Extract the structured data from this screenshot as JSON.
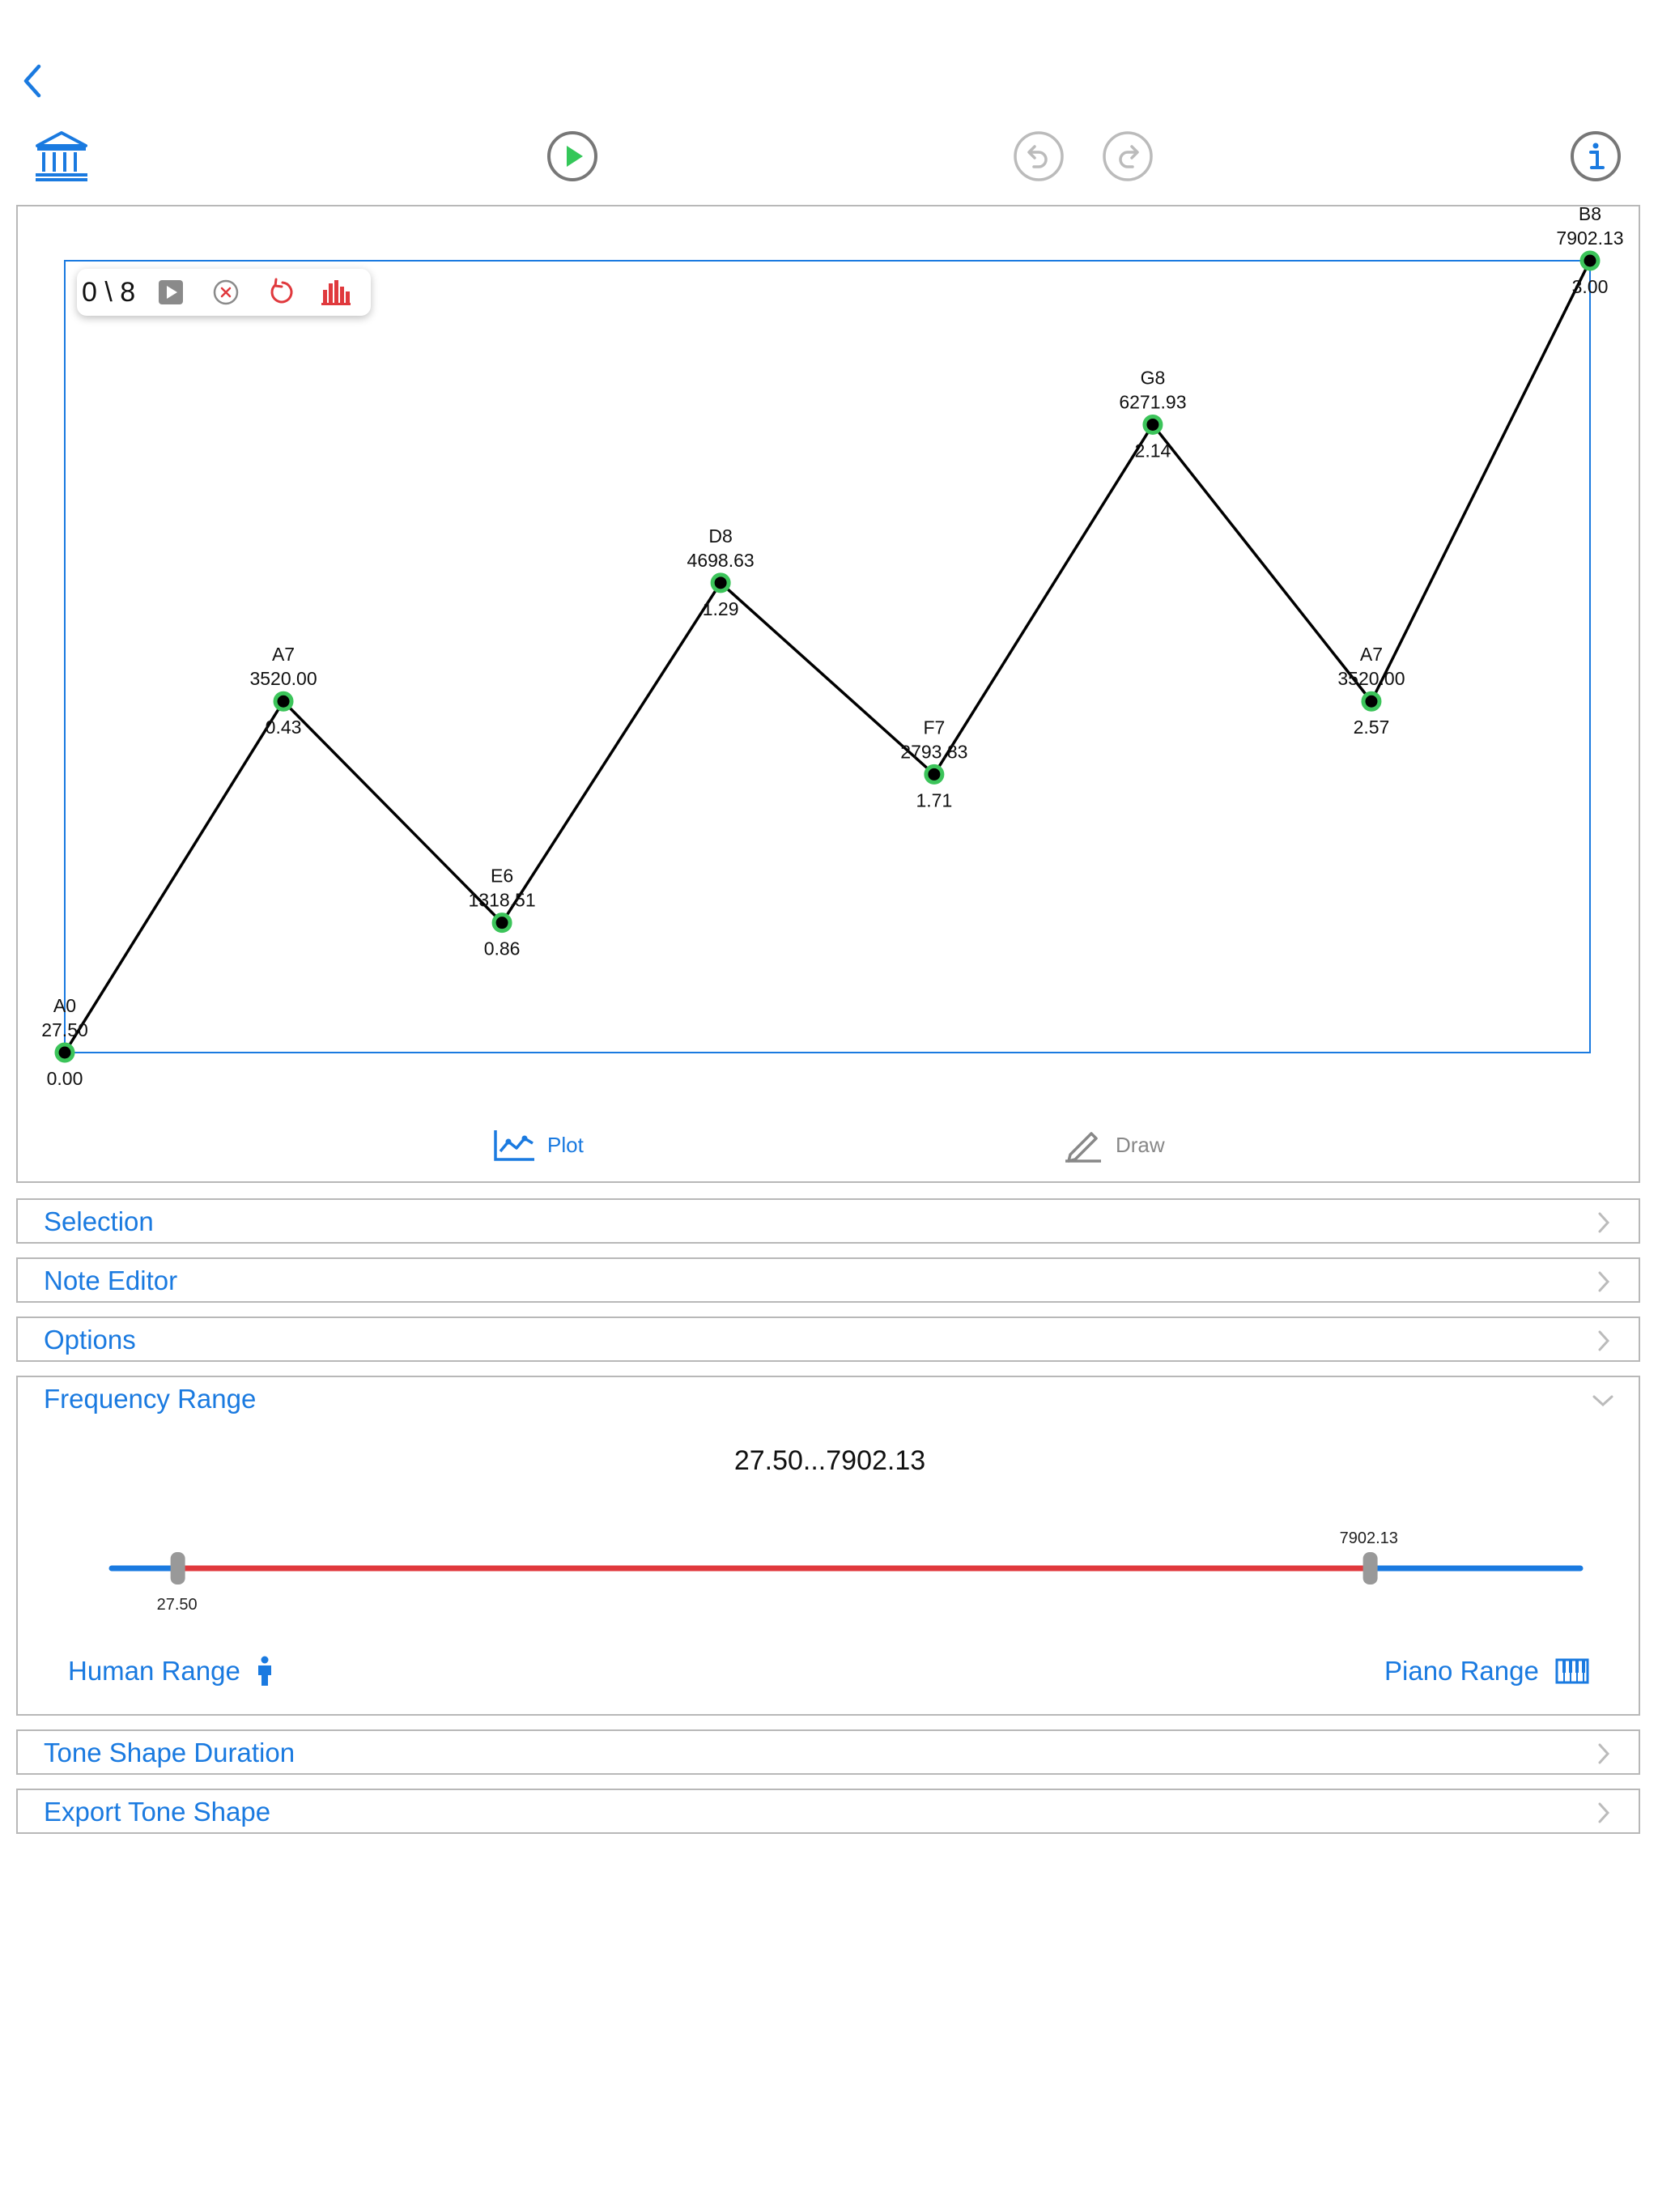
{
  "toolbar": {
    "back_icon": "chevron-left-icon",
    "library_icon": "bank-columns-icon",
    "play_icon": "play-circle-icon",
    "undo_icon": "undo-circle-icon",
    "redo_icon": "redo-circle-icon",
    "info_icon": "info-circle-icon"
  },
  "mini_toolbar": {
    "counter": "0 \\ 8"
  },
  "chart_data": {
    "type": "line",
    "points": [
      {
        "note": "A0",
        "freq": "27.50",
        "time": "0.00"
      },
      {
        "note": "A7",
        "freq": "3520.00",
        "time": "0.43"
      },
      {
        "note": "E6",
        "freq": "1318.51",
        "time": "0.86"
      },
      {
        "note": "D8",
        "freq": "4698.63",
        "time": "1.29"
      },
      {
        "note": "F7",
        "freq": "2793.83",
        "time": "1.71"
      },
      {
        "note": "G8",
        "freq": "6271.93",
        "time": "2.14"
      },
      {
        "note": "A7",
        "freq": "3520.00",
        "time": "2.57"
      },
      {
        "note": "B8",
        "freq": "7902.13",
        "time": "3.00"
      }
    ],
    "x_values": [
      0.0,
      0.43,
      0.86,
      1.29,
      1.71,
      2.14,
      2.57,
      3.0
    ],
    "y_values": [
      27.5,
      3520.0,
      1318.51,
      4698.63,
      2793.83,
      6271.93,
      3520.0,
      7902.13
    ],
    "xlim": [
      0,
      3.0
    ],
    "ylim": [
      27.5,
      7902.13
    ],
    "line_color": "#000000",
    "point_color": "#3cc45a",
    "frame_color": "#1a7ae0"
  },
  "tabs": {
    "plot_label": "Plot",
    "draw_label": "Draw"
  },
  "sections": {
    "selection": "Selection",
    "note_editor": "Note Editor",
    "options": "Options",
    "frequency_range": "Frequency Range",
    "tone_shape_duration": "Tone Shape Duration",
    "export_tone_shape": "Export Tone Shape"
  },
  "frequency_range": {
    "range_text": "27.50...7902.13",
    "low_label": "27.50",
    "high_label": "7902.13",
    "low_fraction": 0.045,
    "high_fraction": 0.857,
    "human_range_label": "Human Range",
    "piano_range_label": "Piano Range",
    "track_color": "#1a7ae0",
    "selected_color": "#e0393d"
  }
}
